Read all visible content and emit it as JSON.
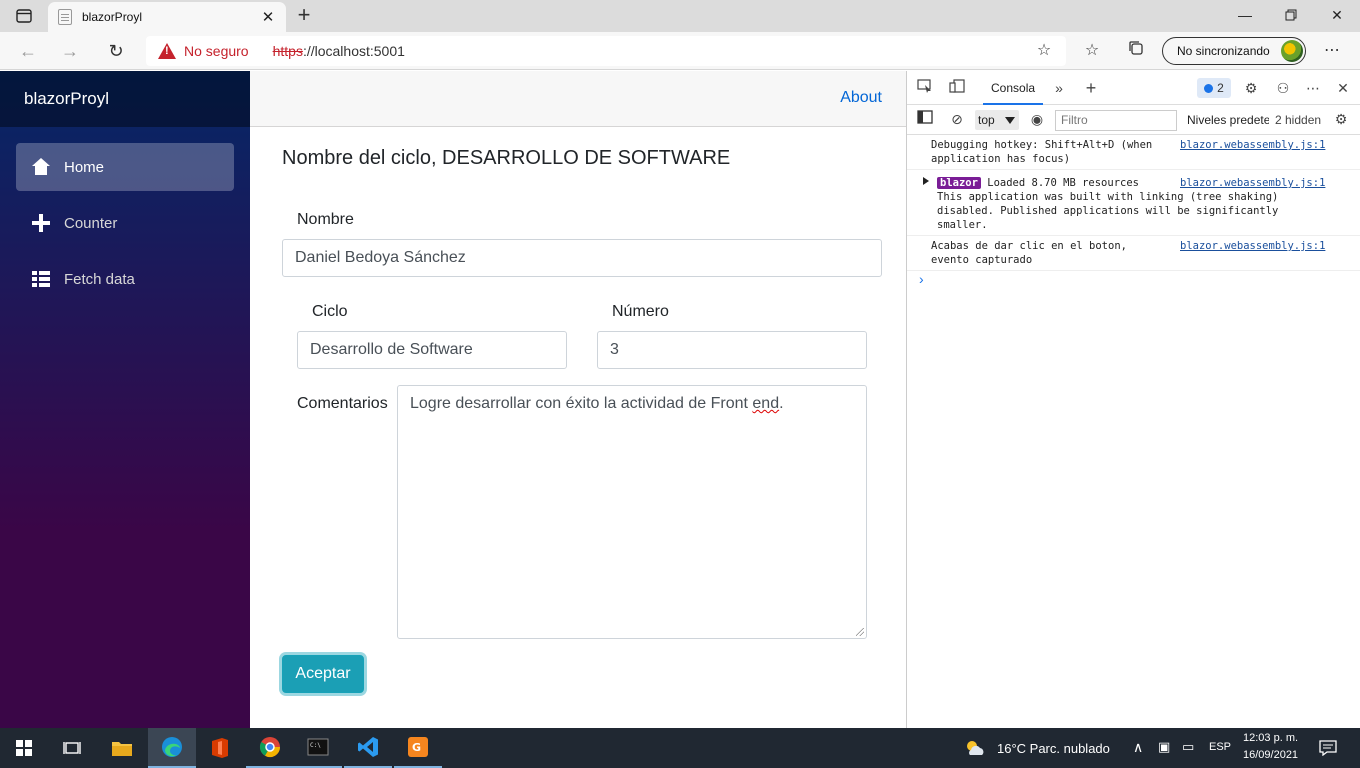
{
  "browser": {
    "tab_title": "blazorProyl",
    "security_label": "No seguro",
    "url_scheme": "https",
    "url_rest": "://localhost:5001",
    "sync_label": "No sincronizando"
  },
  "sidebar": {
    "brand": "blazorProyl",
    "items": [
      {
        "label": "Home",
        "active": true
      },
      {
        "label": "Counter",
        "active": false
      },
      {
        "label": "Fetch data",
        "active": false
      }
    ]
  },
  "header": {
    "about_link": "About"
  },
  "form": {
    "heading": "Nombre del ciclo, DESARROLLO DE SOFTWARE",
    "nombre_label": "Nombre",
    "nombre_value": "Daniel Bedoya Sánchez",
    "ciclo_label": "Ciclo",
    "ciclo_value": "Desarrollo de Software",
    "numero_label": "Número",
    "numero_value": "3",
    "comentarios_label": "Comentarios",
    "comentarios_value_main": "Logre desarrollar con éxito la actividad de Front ",
    "comentarios_value_misspelled": "end",
    "comentarios_value_end": ".",
    "submit_label": "Aceptar"
  },
  "devtools": {
    "console_tab": "Consola",
    "issues_count": "2",
    "context": "top",
    "filter_placeholder": "Filtro",
    "levels_label": "Niveles predeterminados",
    "hidden_label": "2 hidden",
    "logs": [
      {
        "message": "Debugging hotkey: Shift+Alt+D (when application has focus)",
        "source": "blazor.webassembly.js:1"
      },
      {
        "tag": "blazor",
        "message": "Loaded 8.70 MB resources",
        "detail": "This application was built with linking (tree shaking) disabled. Published applications will be significantly smaller.",
        "source": "blazor.webassembly.js:1"
      },
      {
        "message": "Acabas de dar clic en el boton, evento capturado",
        "source": "blazor.webassembly.js:1"
      }
    ]
  },
  "taskbar": {
    "weather": "16°C  Parc. nublado",
    "language": "ESP",
    "time": "12:03 p. m.",
    "date": "16/09/2021"
  }
}
